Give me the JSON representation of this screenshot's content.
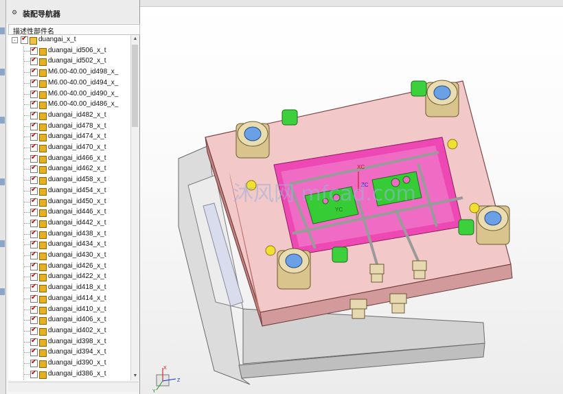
{
  "navigator": {
    "title": "装配导航器",
    "column_header": "描述性部件名",
    "root": "duangai_x_t",
    "items": [
      "duangai_id506_x_t",
      "duangai_id502_x_t",
      "M6.00-40.00_id498_x_",
      "M6.00-40.00_id494_x_",
      "M6.00-40.00_id490_x_",
      "M6.00-40.00_id486_x_",
      "duangai_id482_x_t",
      "duangai_id478_x_t",
      "duangai_id474_x_t",
      "duangai_id470_x_t",
      "duangai_id466_x_t",
      "duangai_id462_x_t",
      "duangai_id458_x_t",
      "duangai_id454_x_t",
      "duangai_id450_x_t",
      "duangai_id446_x_t",
      "duangai_id442_x_t",
      "duangai_id438_x_t",
      "duangai_id434_x_t",
      "duangai_id430_x_t",
      "duangai_id426_x_t",
      "duangai_id422_x_t",
      "duangai_id418_x_t",
      "duangai_id414_x_t",
      "duangai_id410_x_t",
      "duangai_id406_x_t",
      "duangai_id402_x_t",
      "duangai_id398_x_t",
      "duangai_id394_x_t",
      "duangai_id390_x_t",
      "duangai_id386_x_t"
    ]
  },
  "viewport": {
    "axis_labels": {
      "xc": "XC",
      "yc": "YC",
      "zc": "ZC"
    },
    "triad_labels": {
      "x": "X",
      "y": "Y",
      "z": "Z"
    },
    "watermark": "沐风网 mfcad.com"
  },
  "colors": {
    "plate_pink": "#f1c4c4",
    "pocket_magenta": "#ee48b4",
    "insert_green": "#3cd03c",
    "bushing_tan": "#d8c48c",
    "bushing_blue": "#6aa0e6",
    "base_gray": "#d6d6d6",
    "check_red": "#c00000"
  }
}
